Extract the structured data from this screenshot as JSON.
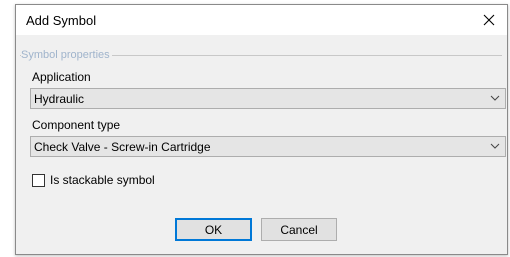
{
  "window": {
    "title": "Add Symbol",
    "close_icon": "close-icon"
  },
  "group": {
    "caption": "Symbol properties"
  },
  "application": {
    "label": "Application",
    "value": "Hydraulic",
    "arrow_icon": "chevron-down-icon"
  },
  "component_type": {
    "label": "Component type",
    "value": "Check Valve - Screw-in Cartridge",
    "arrow_icon": "chevron-down-icon"
  },
  "stackable": {
    "label": "Is stackable symbol",
    "checked": false
  },
  "buttons": {
    "ok_label": "OK",
    "cancel_label": "Cancel"
  },
  "colors": {
    "accent": "#0078d7",
    "group_caption": "#a0b4cc",
    "client_background": "#f0f0f0",
    "combo_background": "#e5e5e5"
  }
}
